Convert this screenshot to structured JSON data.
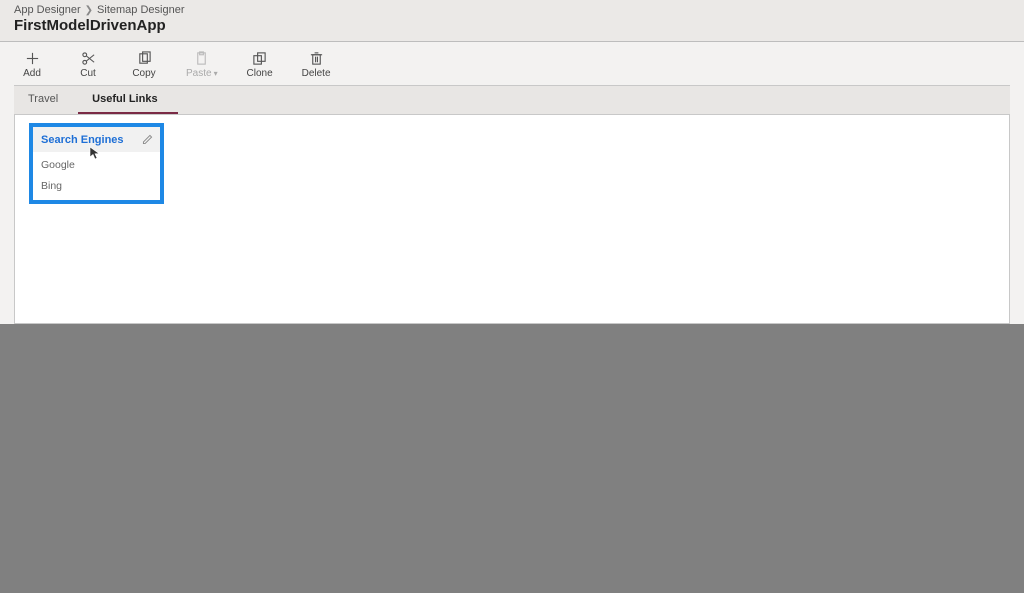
{
  "breadcrumb": {
    "parent": "App Designer",
    "current": "Sitemap Designer"
  },
  "app_title": "FirstModelDrivenApp",
  "toolbar": {
    "add": "Add",
    "cut": "Cut",
    "copy": "Copy",
    "paste": "Paste",
    "clone": "Clone",
    "delete": "Delete"
  },
  "tabs": [
    {
      "label": "Travel",
      "active": false
    },
    {
      "label": "Useful Links",
      "active": true
    }
  ],
  "group": {
    "title": "Search Engines",
    "items": [
      "Google",
      "Bing"
    ]
  },
  "colors": {
    "highlight_border": "#1e88e5",
    "active_tab_underline": "#7a2a45"
  }
}
